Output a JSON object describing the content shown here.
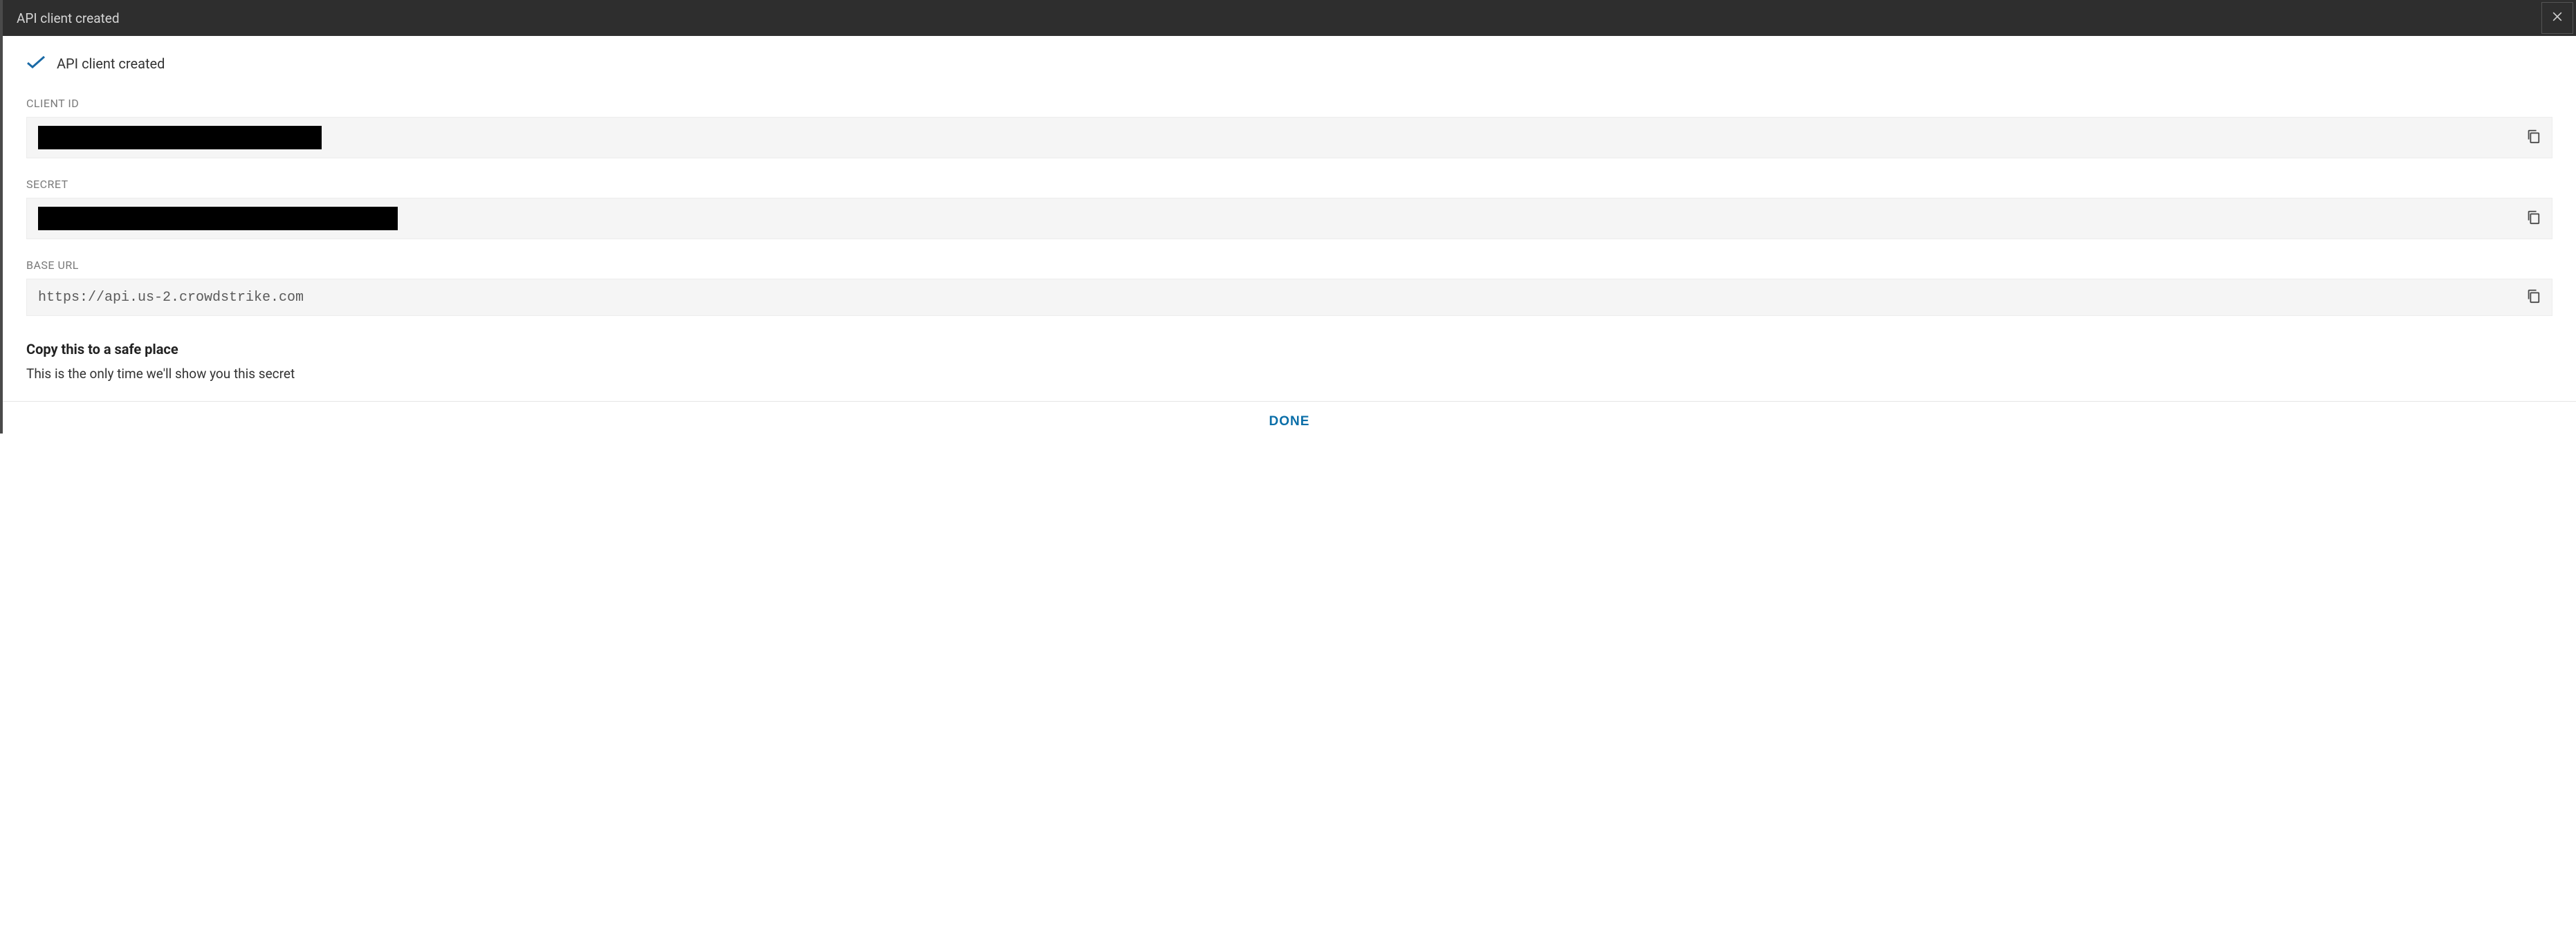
{
  "titlebar": {
    "title": "API client created"
  },
  "status": {
    "message": "API client created"
  },
  "fields": {
    "client_id": {
      "label": "CLIENT ID",
      "value": ""
    },
    "secret": {
      "label": "SECRET",
      "value": ""
    },
    "base_url": {
      "label": "BASE URL",
      "value": "https://api.us-2.crowdstrike.com"
    }
  },
  "warning": {
    "heading": "Copy this to a safe place",
    "text": "This is the only time we'll show you this secret"
  },
  "footer": {
    "done_label": "DONE"
  }
}
